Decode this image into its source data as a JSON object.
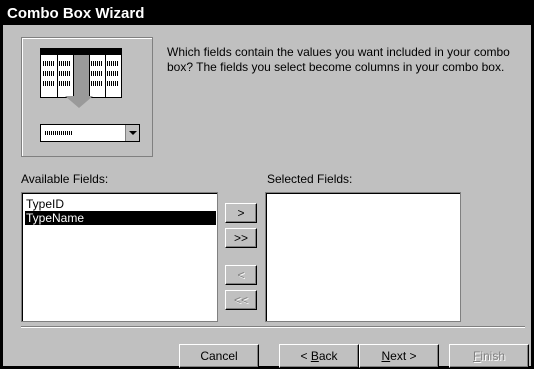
{
  "window": {
    "title": "Combo Box Wizard"
  },
  "instructions": "Which fields contain the values you want included in your combo box? The fields you select become columns in your combo box.",
  "available": {
    "label": "Available Fields:",
    "items": [
      {
        "label": "TypeID",
        "selected": false
      },
      {
        "label": "TypeName",
        "selected": true
      }
    ]
  },
  "selected": {
    "label": "Selected Fields:",
    "items": []
  },
  "move_buttons": {
    "add_one": ">",
    "add_all": ">>",
    "remove_one": "<",
    "remove_all": "<<"
  },
  "footer": {
    "cancel": "Cancel",
    "back_prefix": "< ",
    "back_key": "B",
    "back_rest": "ack",
    "next_key": "N",
    "next_rest": "ext >",
    "finish_key": "F",
    "finish_rest": "inish"
  },
  "colors": {
    "titlebar": "#000000",
    "dialog": "#c0c0c0",
    "selection": "#000000"
  }
}
